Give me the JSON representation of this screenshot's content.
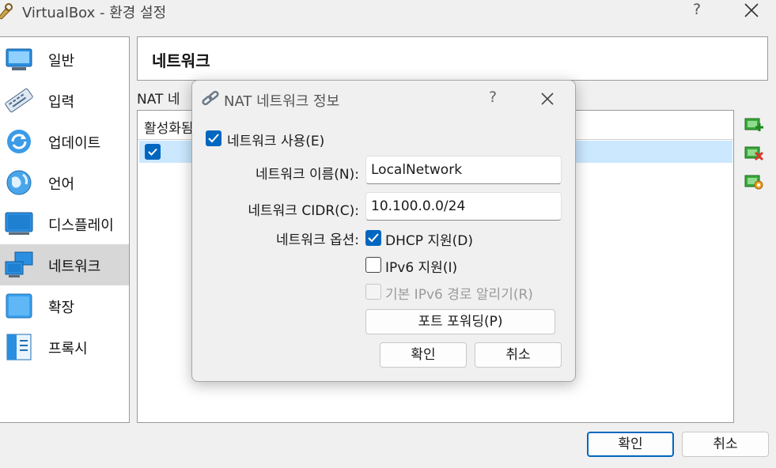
{
  "window": {
    "title": "VirtualBox - 환경 설정",
    "help_glyph": "?"
  },
  "sidebar": {
    "items": [
      {
        "label": "일반",
        "icon": "general-icon"
      },
      {
        "label": "입력",
        "icon": "keyboard-icon"
      },
      {
        "label": "업데이트",
        "icon": "update-icon"
      },
      {
        "label": "언어",
        "icon": "globe-icon"
      },
      {
        "label": "디스플레이",
        "icon": "display-icon"
      },
      {
        "label": "네트워크",
        "icon": "network-icon",
        "selected": true
      },
      {
        "label": "확장",
        "icon": "extension-icon"
      },
      {
        "label": "프록시",
        "icon": "proxy-icon"
      }
    ]
  },
  "page": {
    "title": "네트워크",
    "nat_label": "NAT 네",
    "table_header": "활성화됨",
    "row_checked": true
  },
  "footer": {
    "ok_label": "확인",
    "cancel_label": "취소"
  },
  "dialog": {
    "title": "NAT 네트워크 정보",
    "help_glyph": "?",
    "enable_label": "네트워크 사용(E)",
    "enable_checked": true,
    "name_label": "네트워크 이름(N):",
    "name_value": "LocalNetwork",
    "cidr_label": "네트워크 CIDR(C):",
    "cidr_value": "10.100.0.0/24",
    "options_label": "네트워크 옵션:",
    "dhcp_label": "DHCP 지원(D)",
    "dhcp_checked": true,
    "ipv6_label": "IPv6 지원(I)",
    "ipv6_checked": false,
    "ipv6_route_label": "기본 IPv6 경로 알리기(R)",
    "ipv6_route_enabled": false,
    "port_forward_label": "포트 포워딩(P)",
    "ok_label": "확인",
    "cancel_label": "취소"
  },
  "colors": {
    "accent": "#0067c0",
    "selection": "#cce8ff",
    "sidebar_selected": "#d7d7d7"
  }
}
